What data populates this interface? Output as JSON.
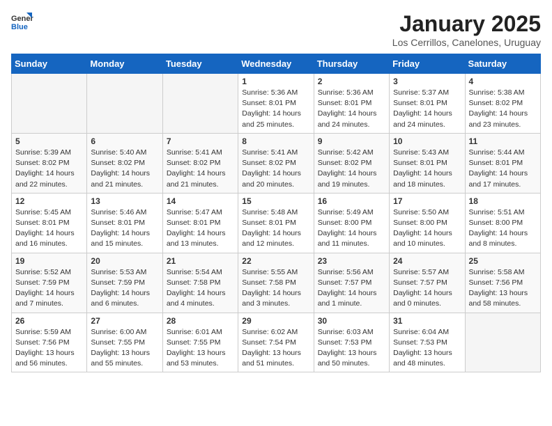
{
  "header": {
    "logo_general": "General",
    "logo_blue": "Blue",
    "title": "January 2025",
    "subtitle": "Los Cerrillos, Canelones, Uruguay"
  },
  "weekdays": [
    "Sunday",
    "Monday",
    "Tuesday",
    "Wednesday",
    "Thursday",
    "Friday",
    "Saturday"
  ],
  "weeks": [
    [
      {
        "day": "",
        "info": ""
      },
      {
        "day": "",
        "info": ""
      },
      {
        "day": "",
        "info": ""
      },
      {
        "day": "1",
        "info": "Sunrise: 5:36 AM\nSunset: 8:01 PM\nDaylight: 14 hours\nand 25 minutes."
      },
      {
        "day": "2",
        "info": "Sunrise: 5:36 AM\nSunset: 8:01 PM\nDaylight: 14 hours\nand 24 minutes."
      },
      {
        "day": "3",
        "info": "Sunrise: 5:37 AM\nSunset: 8:01 PM\nDaylight: 14 hours\nand 24 minutes."
      },
      {
        "day": "4",
        "info": "Sunrise: 5:38 AM\nSunset: 8:02 PM\nDaylight: 14 hours\nand 23 minutes."
      }
    ],
    [
      {
        "day": "5",
        "info": "Sunrise: 5:39 AM\nSunset: 8:02 PM\nDaylight: 14 hours\nand 22 minutes."
      },
      {
        "day": "6",
        "info": "Sunrise: 5:40 AM\nSunset: 8:02 PM\nDaylight: 14 hours\nand 21 minutes."
      },
      {
        "day": "7",
        "info": "Sunrise: 5:41 AM\nSunset: 8:02 PM\nDaylight: 14 hours\nand 21 minutes."
      },
      {
        "day": "8",
        "info": "Sunrise: 5:41 AM\nSunset: 8:02 PM\nDaylight: 14 hours\nand 20 minutes."
      },
      {
        "day": "9",
        "info": "Sunrise: 5:42 AM\nSunset: 8:02 PM\nDaylight: 14 hours\nand 19 minutes."
      },
      {
        "day": "10",
        "info": "Sunrise: 5:43 AM\nSunset: 8:01 PM\nDaylight: 14 hours\nand 18 minutes."
      },
      {
        "day": "11",
        "info": "Sunrise: 5:44 AM\nSunset: 8:01 PM\nDaylight: 14 hours\nand 17 minutes."
      }
    ],
    [
      {
        "day": "12",
        "info": "Sunrise: 5:45 AM\nSunset: 8:01 PM\nDaylight: 14 hours\nand 16 minutes."
      },
      {
        "day": "13",
        "info": "Sunrise: 5:46 AM\nSunset: 8:01 PM\nDaylight: 14 hours\nand 15 minutes."
      },
      {
        "day": "14",
        "info": "Sunrise: 5:47 AM\nSunset: 8:01 PM\nDaylight: 14 hours\nand 13 minutes."
      },
      {
        "day": "15",
        "info": "Sunrise: 5:48 AM\nSunset: 8:01 PM\nDaylight: 14 hours\nand 12 minutes."
      },
      {
        "day": "16",
        "info": "Sunrise: 5:49 AM\nSunset: 8:00 PM\nDaylight: 14 hours\nand 11 minutes."
      },
      {
        "day": "17",
        "info": "Sunrise: 5:50 AM\nSunset: 8:00 PM\nDaylight: 14 hours\nand 10 minutes."
      },
      {
        "day": "18",
        "info": "Sunrise: 5:51 AM\nSunset: 8:00 PM\nDaylight: 14 hours\nand 8 minutes."
      }
    ],
    [
      {
        "day": "19",
        "info": "Sunrise: 5:52 AM\nSunset: 7:59 PM\nDaylight: 14 hours\nand 7 minutes."
      },
      {
        "day": "20",
        "info": "Sunrise: 5:53 AM\nSunset: 7:59 PM\nDaylight: 14 hours\nand 6 minutes."
      },
      {
        "day": "21",
        "info": "Sunrise: 5:54 AM\nSunset: 7:58 PM\nDaylight: 14 hours\nand 4 minutes."
      },
      {
        "day": "22",
        "info": "Sunrise: 5:55 AM\nSunset: 7:58 PM\nDaylight: 14 hours\nand 3 minutes."
      },
      {
        "day": "23",
        "info": "Sunrise: 5:56 AM\nSunset: 7:57 PM\nDaylight: 14 hours\nand 1 minute."
      },
      {
        "day": "24",
        "info": "Sunrise: 5:57 AM\nSunset: 7:57 PM\nDaylight: 14 hours\nand 0 minutes."
      },
      {
        "day": "25",
        "info": "Sunrise: 5:58 AM\nSunset: 7:56 PM\nDaylight: 13 hours\nand 58 minutes."
      }
    ],
    [
      {
        "day": "26",
        "info": "Sunrise: 5:59 AM\nSunset: 7:56 PM\nDaylight: 13 hours\nand 56 minutes."
      },
      {
        "day": "27",
        "info": "Sunrise: 6:00 AM\nSunset: 7:55 PM\nDaylight: 13 hours\nand 55 minutes."
      },
      {
        "day": "28",
        "info": "Sunrise: 6:01 AM\nSunset: 7:55 PM\nDaylight: 13 hours\nand 53 minutes."
      },
      {
        "day": "29",
        "info": "Sunrise: 6:02 AM\nSunset: 7:54 PM\nDaylight: 13 hours\nand 51 minutes."
      },
      {
        "day": "30",
        "info": "Sunrise: 6:03 AM\nSunset: 7:53 PM\nDaylight: 13 hours\nand 50 minutes."
      },
      {
        "day": "31",
        "info": "Sunrise: 6:04 AM\nSunset: 7:53 PM\nDaylight: 13 hours\nand 48 minutes."
      },
      {
        "day": "",
        "info": ""
      }
    ]
  ]
}
